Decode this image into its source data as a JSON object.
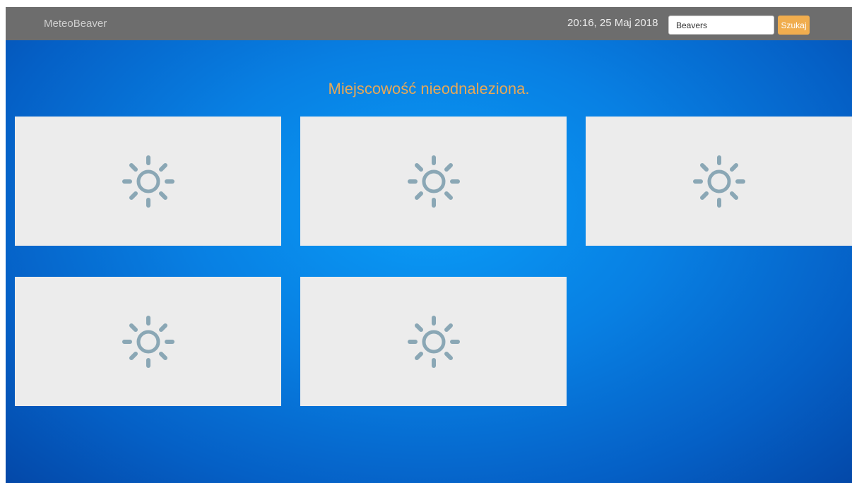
{
  "app": {
    "brand": "MeteoBeaver",
    "datetime": "20:16, 25 Maj 2018"
  },
  "search": {
    "value": "Beavers",
    "button_label": "Szukaj"
  },
  "main": {
    "message": "Miejscowość nieodnaleziona.",
    "cards": [
      {
        "icon": "sun-icon"
      },
      {
        "icon": "sun-icon"
      },
      {
        "icon": "sun-icon"
      },
      {
        "icon": "sun-icon"
      },
      {
        "icon": "sun-icon"
      }
    ]
  },
  "colors": {
    "navbar": "#6d6d6d",
    "accent": "#f0ad4e",
    "message": "#e6a857",
    "card": "#ececec",
    "icon": "#8aa7b5",
    "background": "#0880e3"
  }
}
